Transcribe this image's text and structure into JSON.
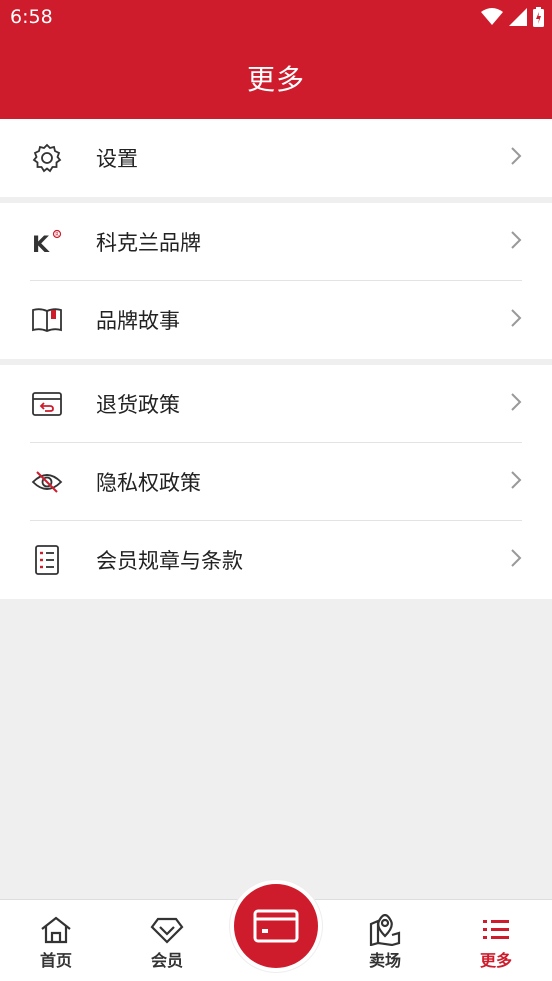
{
  "status": {
    "time": "6:58"
  },
  "header": {
    "title": "更多"
  },
  "groups": [
    {
      "items": [
        {
          "label": "设置",
          "icon": "gear-icon"
        }
      ]
    },
    {
      "items": [
        {
          "label": "科克兰品牌",
          "icon": "brand-k-logo-icon"
        },
        {
          "label": "品牌故事",
          "icon": "book-icon"
        }
      ]
    },
    {
      "items": [
        {
          "label": "退货政策",
          "icon": "return-box-icon"
        },
        {
          "label": "隐私权政策",
          "icon": "eye-off-icon"
        },
        {
          "label": "会员规章与条款",
          "icon": "checklist-icon"
        }
      ]
    }
  ],
  "tabbar": {
    "home": "首页",
    "member": "会员",
    "center": "card-icon",
    "stores": "卖场",
    "more": "更多"
  },
  "colors": {
    "brand": "#cf1c2c",
    "background": "#efefef"
  }
}
